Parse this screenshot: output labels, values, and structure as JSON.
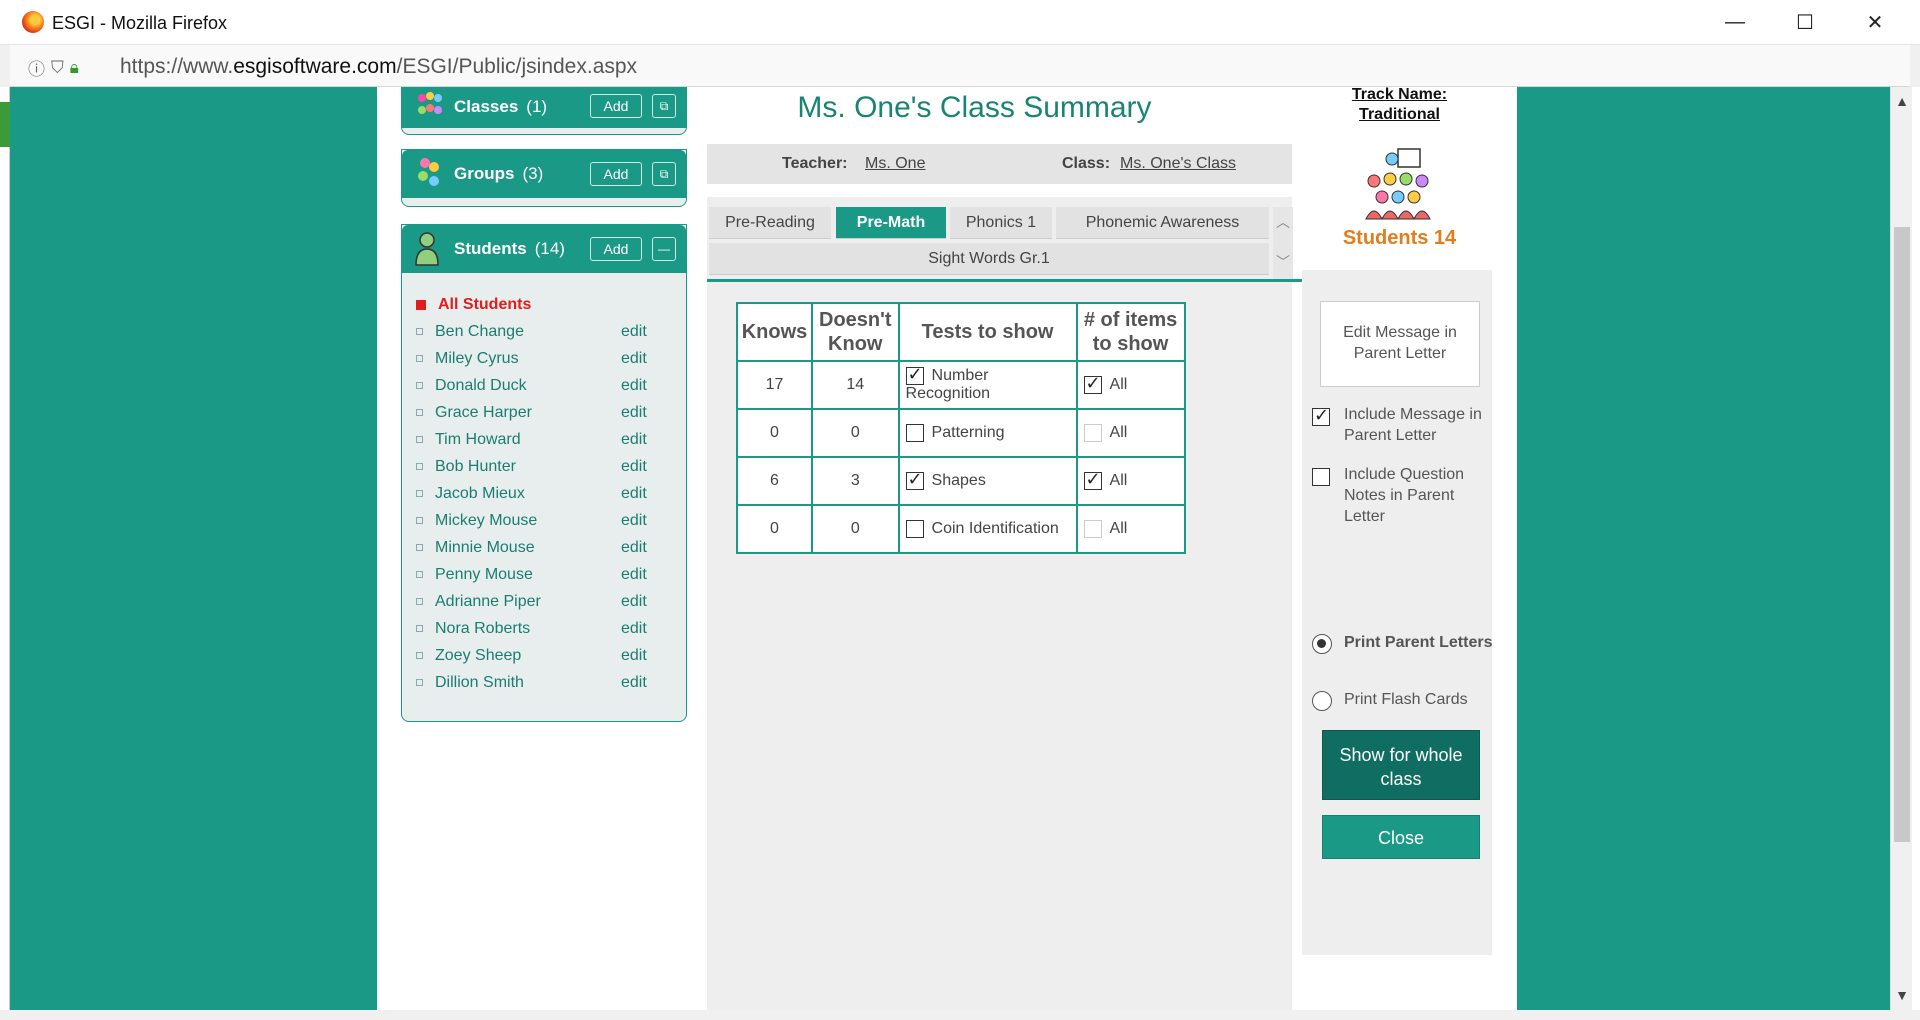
{
  "browser": {
    "title": "ESGI - Mozilla Firefox",
    "url_prefix": "https://www.",
    "url_domain": "esgisoftware.com",
    "url_path": "/ESGI/Public/jsindex.aspx",
    "minimize": "—",
    "maximize": "☐",
    "close": "✕"
  },
  "sidebar": {
    "classes": {
      "title": "Classes",
      "count": "(1)",
      "add": "Add"
    },
    "groups": {
      "title": "Groups",
      "count": "(3)",
      "add": "Add"
    },
    "students": {
      "title": "Students",
      "count": "(14)",
      "add": "Add",
      "all_label": "All Students",
      "edit_label": "edit",
      "items": [
        "Ben Change",
        "Miley Cyrus",
        "Donald Duck",
        "Grace Harper",
        "Tim Howard",
        "Bob Hunter",
        "Jacob Mieux",
        "Mickey Mouse",
        "Minnie Mouse",
        "Penny Mouse",
        "Adrianne Piper",
        "Nora Roberts",
        "Zoey Sheep",
        "Dillion Smith"
      ]
    }
  },
  "summary": {
    "title": "Ms. One's Class Summary",
    "teacher_label": "Teacher:",
    "teacher_value": "Ms. One",
    "class_label": "Class:",
    "class_value": "Ms. One's Class"
  },
  "tabs": [
    "Pre-Reading",
    "Pre-Math",
    "Phonics 1",
    "Phonemic Awareness",
    "Sight Words Gr.1"
  ],
  "active_tab": "Pre-Math",
  "table": {
    "headers": [
      "Knows",
      "Doesn't Know",
      "Tests to show",
      "# of items to show"
    ],
    "rows": [
      {
        "knows": "17",
        "doesnt_know": "14",
        "test": "Number Recognition",
        "test_checked": true,
        "items": "All",
        "items_checked": true
      },
      {
        "knows": "0",
        "doesnt_know": "0",
        "test": "Patterning",
        "test_checked": false,
        "items": "All",
        "items_checked": false
      },
      {
        "knows": "6",
        "doesnt_know": "3",
        "test": "Shapes",
        "test_checked": true,
        "items": "All",
        "items_checked": true
      },
      {
        "knows": "0",
        "doesnt_know": "0",
        "test": "Coin Identification",
        "test_checked": false,
        "items": "All",
        "items_checked": false
      }
    ]
  },
  "right": {
    "track_line1": "Track Name:",
    "track_line2": "Traditional",
    "students_count": "Students 14",
    "edit_message": "Edit Message in Parent Letter",
    "include_message": "Include Message in Parent Letter",
    "include_message_checked": true,
    "include_notes": "Include Question Notes in Parent Letter",
    "include_notes_checked": false,
    "print_letters": "Print Parent Letters",
    "print_letters_selected": true,
    "print_flash": "Print Flash Cards",
    "print_flash_selected": false,
    "show_whole_class": "Show for whole class",
    "close": "Close"
  },
  "colors": {
    "teal": "#1a9986",
    "dark_teal": "#0f6e61",
    "orange": "#e27d1a",
    "red": "#e31b1b"
  }
}
